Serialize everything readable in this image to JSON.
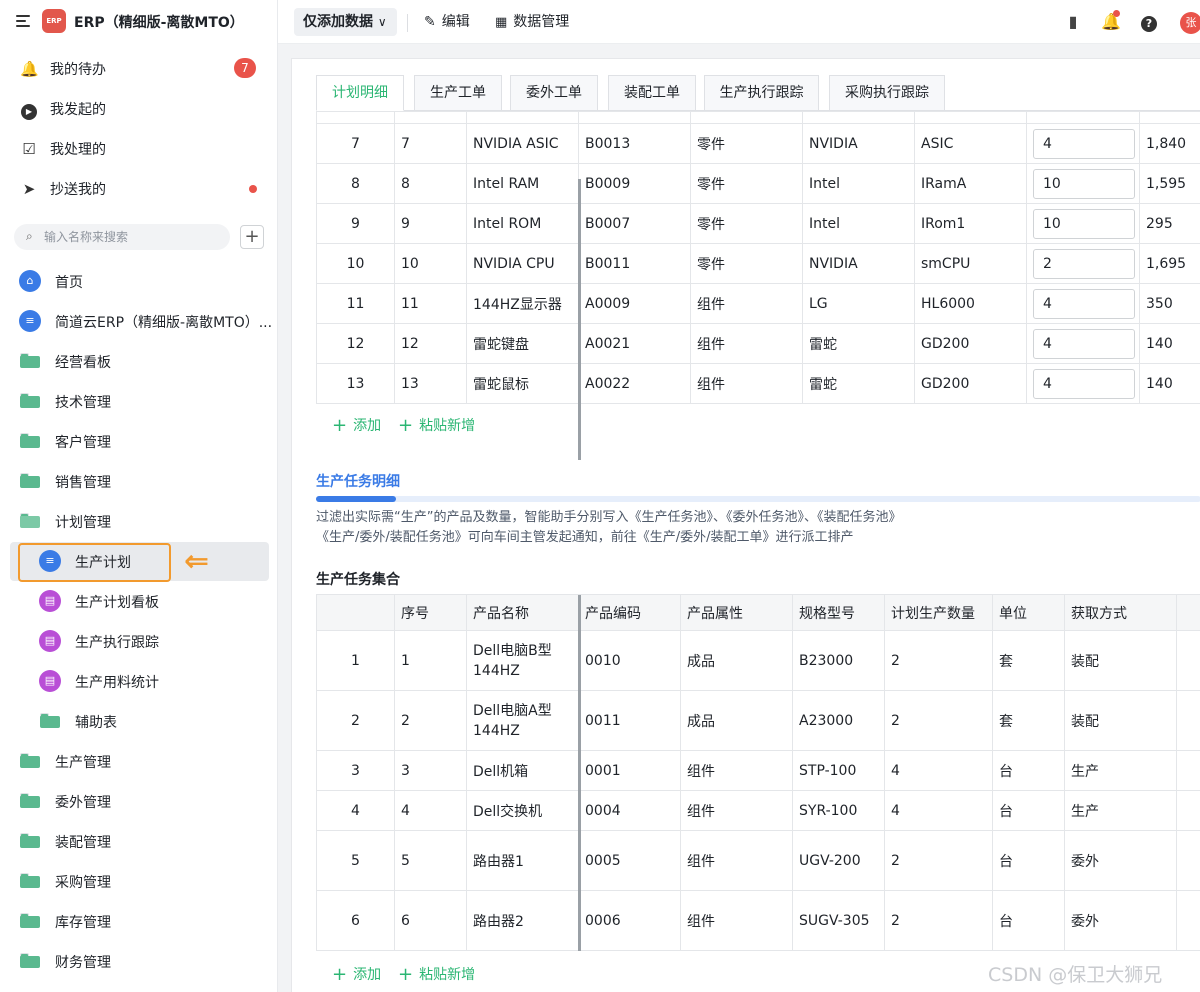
{
  "app": {
    "title": "ERP（精细版-离散MTO）",
    "logo_text": "ERP",
    "accent": "#2bb673",
    "warning": "#f29a2e"
  },
  "topbar": {
    "mode_label": "仅添加数据",
    "mode_chevron": "∨",
    "edit_label": "编辑",
    "data_manage_label": "数据管理",
    "avatar_text": "张"
  },
  "sidebar": {
    "quick": [
      {
        "label": "我的待办",
        "icon": "bell-icon",
        "badge": "7"
      },
      {
        "label": "我发起的",
        "icon": "play-icon"
      },
      {
        "label": "我处理的",
        "icon": "check-box-icon"
      },
      {
        "label": "抄送我的",
        "icon": "send-icon",
        "dot": true
      }
    ],
    "search_placeholder": "输入名称来搜索",
    "items": [
      {
        "label": "首页",
        "icon": "home-icon"
      },
      {
        "label": "简道云ERP（精细版-离散MTO）...",
        "icon": "document-icon"
      },
      {
        "label": "经营看板",
        "icon": "folder-icon"
      },
      {
        "label": "技术管理",
        "icon": "folder-icon"
      },
      {
        "label": "客户管理",
        "icon": "folder-icon"
      },
      {
        "label": "销售管理",
        "icon": "folder-icon"
      },
      {
        "label": "计划管理",
        "icon": "folder-open-icon"
      },
      {
        "label": "生产计划",
        "icon": "form-icon",
        "active": true
      },
      {
        "label": "生产计划看板",
        "icon": "dashboard-icon"
      },
      {
        "label": "生产执行跟踪",
        "icon": "dashboard-icon"
      },
      {
        "label": "生产用料统计",
        "icon": "dashboard-icon"
      },
      {
        "label": "辅助表",
        "icon": "folder-icon"
      },
      {
        "label": "生产管理",
        "icon": "folder-icon"
      },
      {
        "label": "委外管理",
        "icon": "folder-icon"
      },
      {
        "label": "装配管理",
        "icon": "folder-icon"
      },
      {
        "label": "采购管理",
        "icon": "folder-icon"
      },
      {
        "label": "库存管理",
        "icon": "folder-icon"
      },
      {
        "label": "财务管理",
        "icon": "folder-icon"
      }
    ]
  },
  "tabs": [
    "计划明细",
    "生产工单",
    "委外工单",
    "装配工单",
    "生产执行跟踪",
    "采购执行跟踪"
  ],
  "plan_table": {
    "rows": [
      [
        "7",
        "7",
        "NVIDIA ASIC",
        "B0013",
        "零件",
        "NVIDIA",
        "ASIC",
        "4",
        "1,840"
      ],
      [
        "8",
        "8",
        "Intel RAM",
        "B0009",
        "零件",
        "Intel",
        "IRamA",
        "10",
        "1,595"
      ],
      [
        "9",
        "9",
        "Intel ROM",
        "B0007",
        "零件",
        "Intel",
        "IRom1",
        "10",
        "295"
      ],
      [
        "10",
        "10",
        "NVIDIA CPU",
        "B0011",
        "零件",
        "NVIDIA",
        "smCPU",
        "2",
        "1,695"
      ],
      [
        "11",
        "11",
        "144HZ显示器",
        "A0009",
        "组件",
        "LG",
        "HL6000",
        "4",
        "350"
      ],
      [
        "12",
        "12",
        "雷蛇键盘",
        "A0021",
        "组件",
        "雷蛇",
        "GD200",
        "4",
        "140"
      ],
      [
        "13",
        "13",
        "雷蛇鼠标",
        "A0022",
        "组件",
        "雷蛇",
        "GD200",
        "4",
        "140"
      ]
    ],
    "add_label": "添加",
    "paste_label": "粘贴新增"
  },
  "task_section": {
    "title": "生产任务明细",
    "progress": 0.09,
    "desc_line1": "过滤出实际需“生产”的产品及数量，智能助手分别写入《生产任务池》、《委外任务池》、《装配任务池》",
    "desc_line2": "《生产/委外/装配任务池》可向车间主管发起通知，前往《生产/委外/装配工单》进行派工排产"
  },
  "task_table": {
    "title": "生产任务集合",
    "headers": [
      "",
      "序号",
      "产品名称",
      "产品编码",
      "产品属性",
      "规格型号",
      "计划生产数量",
      "单位",
      "获取方式"
    ],
    "rows": [
      [
        "1",
        "1",
        "Dell电脑B型 144HZ",
        "0010",
        "成品",
        "B23000",
        "2",
        "套",
        "装配"
      ],
      [
        "2",
        "2",
        "Dell电脑A型 144HZ",
        "0011",
        "成品",
        "A23000",
        "2",
        "套",
        "装配"
      ],
      [
        "3",
        "3",
        "Dell机箱",
        "0001",
        "组件",
        "STP-100",
        "4",
        "台",
        "生产"
      ],
      [
        "4",
        "4",
        "Dell交换机",
        "0004",
        "组件",
        "SYR-100",
        "4",
        "台",
        "生产"
      ],
      [
        "5",
        "5",
        "路由器1",
        "0005",
        "组件",
        "UGV-200",
        "2",
        "台",
        "委外"
      ],
      [
        "6",
        "6",
        "路由器2",
        "0006",
        "组件",
        "SUGV-305",
        "2",
        "台",
        "委外"
      ]
    ],
    "add_label": "添加",
    "paste_label": "粘贴新增"
  },
  "watermark": "CSDN @保卫大狮兄"
}
